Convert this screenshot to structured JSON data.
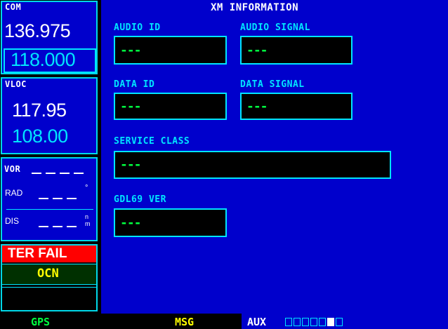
{
  "left": {
    "com": {
      "tag": "COM",
      "active": "136.975",
      "standby": "118.000"
    },
    "vloc": {
      "tag": "VLOC",
      "active": "117.95",
      "standby": "108.00"
    },
    "vor": {
      "tag": "VOR",
      "rad_label": "RAD",
      "rad_unit": "°",
      "dis_label": "DIS",
      "dis_unit_top": "n",
      "dis_unit_bottom": "m"
    },
    "ter_fail": "TER FAIL",
    "ocn": "OCN"
  },
  "main": {
    "title": "XM INFORMATION",
    "audio_id": {
      "label": "AUDIO ID",
      "value": "---"
    },
    "audio_signal": {
      "label": "AUDIO SIGNAL",
      "value": "---"
    },
    "data_id": {
      "label": "DATA ID",
      "value": "---"
    },
    "data_signal": {
      "label": "DATA SIGNAL",
      "value": "---"
    },
    "service_class": {
      "label": "SERVICE CLASS",
      "value": "---"
    },
    "gdl69_ver": {
      "label": "GDL69 VER",
      "value": "---"
    }
  },
  "bottom": {
    "gps": "GPS",
    "msg": "MSG",
    "aux": "AUX",
    "page_count": 7,
    "active_page": 6
  },
  "colors": {
    "cyan": "#00e5ff",
    "green": "#00ff40",
    "blue": "#0000cc",
    "yellow": "#ffff00",
    "red": "#ff0000"
  }
}
